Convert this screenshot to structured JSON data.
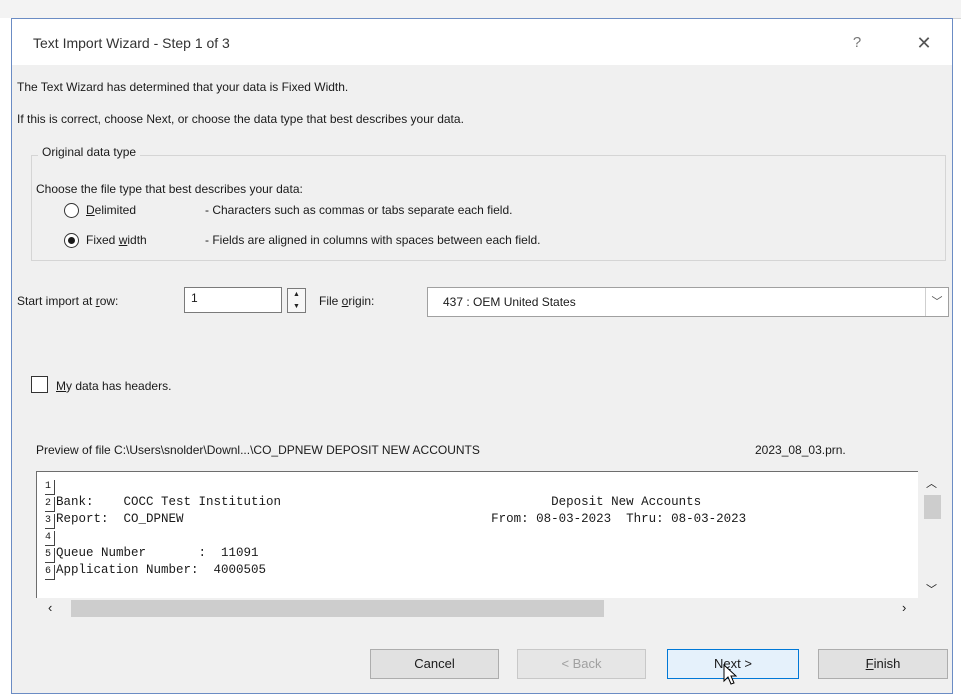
{
  "dialog": {
    "title": "Text Import Wizard - Step 1 of 3",
    "help_label": "?",
    "close_label": "✕"
  },
  "intro": {
    "line1": "The Text Wizard has determined that your data is Fixed Width.",
    "line2": "If this is correct, choose Next, or choose the data type that best describes your data."
  },
  "original_type": {
    "group_title": "Original data type",
    "prompt": "Choose the file type that best describes your data:",
    "options": [
      {
        "label_pre": "",
        "label_u": "D",
        "label_post": "elimited",
        "description": "- Characters such as commas or tabs separate each field.",
        "selected": false
      },
      {
        "label_pre": "Fixed ",
        "label_u": "w",
        "label_post": "idth",
        "description": "- Fields are aligned in columns with spaces between each field.",
        "selected": true
      }
    ]
  },
  "start_row": {
    "label_pre": "Start import at ",
    "label_u": "r",
    "label_post": "ow:",
    "value": "1"
  },
  "file_origin": {
    "label_pre": "File ",
    "label_u": "o",
    "label_post": "rigin:",
    "value": "437 : OEM United States"
  },
  "headers": {
    "label_u": "M",
    "label_post": "y data has headers.",
    "checked": false
  },
  "preview": {
    "label": "Preview of file C:\\Users\\snolder\\Downl...\\CO_DPNEW DEPOSIT NEW ACCOUNTS",
    "label_suffix": "2023_08_03.prn.",
    "lines": [
      {
        "num": "1",
        "text": ""
      },
      {
        "num": "2",
        "text": "Bank:    COCC Test Institution                                    Deposit New Accounts"
      },
      {
        "num": "3",
        "text": "Report:  CO_DPNEW                                         From: 08-03-2023  Thru: 08-03-2023"
      },
      {
        "num": "4",
        "text": ""
      },
      {
        "num": "5",
        "text": "Queue Number       :  11091"
      },
      {
        "num": "6",
        "text": "Application Number:  4000505"
      }
    ]
  },
  "buttons": {
    "cancel": "Cancel",
    "back": "< Back",
    "next_pre": "N",
    "next_u": "e",
    "next_post": "xt >",
    "finish_u": "F",
    "finish_post": "inish"
  }
}
